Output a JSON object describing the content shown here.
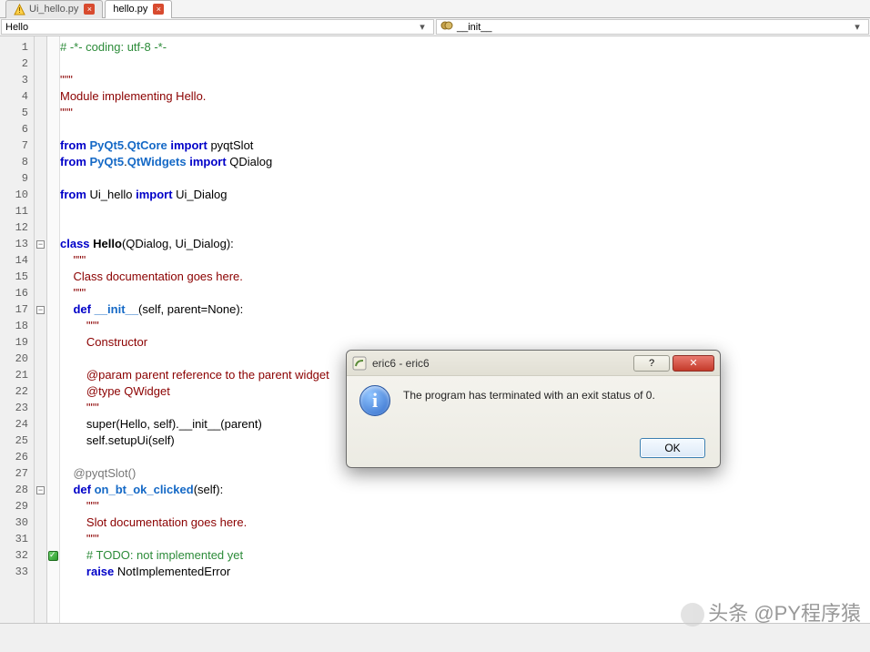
{
  "tabs": [
    {
      "label": "Ui_hello.py",
      "active": false,
      "has_warning": true
    },
    {
      "label": "hello.py",
      "active": true,
      "has_warning": false
    }
  ],
  "nav": {
    "class_dropdown": "Hello",
    "member_dropdown": "__init__"
  },
  "gutter": {
    "first": 1,
    "last": 33
  },
  "fold_minus_lines": [
    13,
    17,
    28
  ],
  "bookmark_lines": [
    32
  ],
  "code": {
    "l1": [
      {
        "cls": "com",
        "t": "# -*- coding: utf-8 -*-"
      }
    ],
    "l2": [],
    "l3": [
      {
        "cls": "str",
        "t": "\"\"\""
      }
    ],
    "l4": [
      {
        "cls": "str",
        "t": "Module implementing Hello."
      }
    ],
    "l5": [
      {
        "cls": "str",
        "t": "\"\"\""
      }
    ],
    "l6": [],
    "l7": [
      {
        "cls": "kw",
        "t": "from "
      },
      {
        "cls": "fn",
        "t": "PyQt5"
      },
      {
        "cls": "txt",
        "t": "."
      },
      {
        "cls": "fn",
        "t": "QtCore"
      },
      {
        "cls": "kw",
        "t": " import "
      },
      {
        "cls": "txt",
        "t": "pyqtSlot"
      }
    ],
    "l8": [
      {
        "cls": "kw",
        "t": "from "
      },
      {
        "cls": "fn",
        "t": "PyQt5"
      },
      {
        "cls": "txt",
        "t": "."
      },
      {
        "cls": "fn",
        "t": "QtWidgets"
      },
      {
        "cls": "kw",
        "t": " import "
      },
      {
        "cls": "txt",
        "t": "QDialog"
      }
    ],
    "l9": [],
    "l10": [
      {
        "cls": "kw",
        "t": "from "
      },
      {
        "cls": "txt",
        "t": "Ui_hello"
      },
      {
        "cls": "kw",
        "t": " import "
      },
      {
        "cls": "txt",
        "t": "Ui_Dialog"
      }
    ],
    "l11": [],
    "l12": [],
    "l13": [
      {
        "cls": "kw",
        "t": "class "
      },
      {
        "cls": "cls",
        "t": "Hello"
      },
      {
        "cls": "txt",
        "t": "(QDialog, Ui_Dialog):"
      }
    ],
    "l14": [
      {
        "cls": "str",
        "t": "    \"\"\""
      }
    ],
    "l15": [
      {
        "cls": "str",
        "t": "    Class documentation goes here."
      }
    ],
    "l16": [
      {
        "cls": "str",
        "t": "    \"\"\""
      }
    ],
    "l17": [
      {
        "cls": "txt",
        "t": "    "
      },
      {
        "cls": "kw",
        "t": "def "
      },
      {
        "cls": "fn",
        "t": "__init__"
      },
      {
        "cls": "txt",
        "t": "(self, parent=None):"
      }
    ],
    "l18": [
      {
        "cls": "str",
        "t": "        \"\"\""
      }
    ],
    "l19": [
      {
        "cls": "str",
        "t": "        Constructor"
      }
    ],
    "l20": [
      {
        "cls": "str",
        "t": "        "
      }
    ],
    "l21": [
      {
        "cls": "str",
        "t": "        @param parent reference to the parent widget"
      }
    ],
    "l22": [
      {
        "cls": "str",
        "t": "        @type QWidget"
      }
    ],
    "l23": [
      {
        "cls": "str",
        "t": "        \"\"\""
      }
    ],
    "l24": [
      {
        "cls": "txt",
        "t": "        super(Hello, self).__init__(parent)"
      }
    ],
    "l25": [
      {
        "cls": "txt",
        "t": "        self.setupUi(self)"
      }
    ],
    "l26": [
      {
        "cls": "txt",
        "t": "    "
      }
    ],
    "l27": [
      {
        "cls": "txt",
        "t": "    "
      },
      {
        "cls": "dec",
        "t": "@pyqtSlot()"
      }
    ],
    "l28": [
      {
        "cls": "txt",
        "t": "    "
      },
      {
        "cls": "kw",
        "t": "def "
      },
      {
        "cls": "fn",
        "t": "on_bt_ok_clicked"
      },
      {
        "cls": "txt",
        "t": "(self):"
      }
    ],
    "l29": [
      {
        "cls": "str",
        "t": "        \"\"\""
      }
    ],
    "l30": [
      {
        "cls": "str",
        "t": "        Slot documentation goes here."
      }
    ],
    "l31": [
      {
        "cls": "str",
        "t": "        \"\"\""
      }
    ],
    "l32": [
      {
        "cls": "txt",
        "t": "        "
      },
      {
        "cls": "com",
        "t": "# TODO: not implemented yet"
      }
    ],
    "l33": [
      {
        "cls": "txt",
        "t": "        "
      },
      {
        "cls": "kw",
        "t": "raise "
      },
      {
        "cls": "txt",
        "t": "NotImplementedError"
      }
    ]
  },
  "dialog": {
    "title": "eric6 - eric6",
    "message": "The program has terminated with an exit status of 0.",
    "ok_label": "OK",
    "help_glyph": "?",
    "close_glyph": "✕",
    "info_glyph": "i"
  },
  "watermark": "头条 @PY程序猿"
}
